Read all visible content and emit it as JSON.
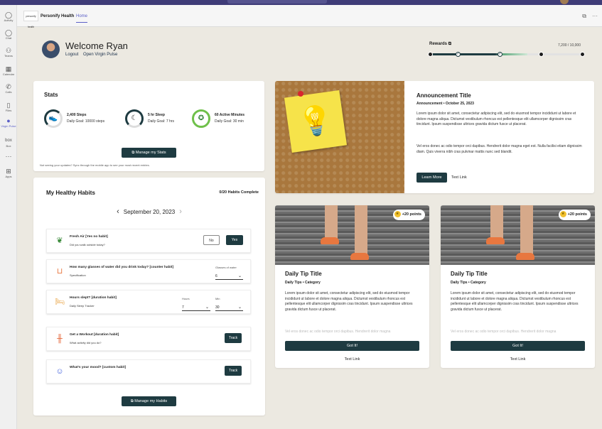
{
  "header": {
    "app_name": "Personify Health",
    "logo_text": "personify health",
    "tab": "Home"
  },
  "rail": [
    {
      "icon": "bell-icon",
      "glyph": "◯",
      "label": "Activity"
    },
    {
      "icon": "chat-icon",
      "glyph": "◯",
      "label": "Chat"
    },
    {
      "icon": "teams-icon",
      "glyph": "⚇",
      "label": "Teams"
    },
    {
      "icon": "calendar-icon",
      "glyph": "▦",
      "label": "Calendar"
    },
    {
      "icon": "calls-icon",
      "glyph": "✆",
      "label": "Calls"
    },
    {
      "icon": "files-icon",
      "glyph": "▯",
      "label": "Files"
    },
    {
      "icon": "virgin-pulse-icon",
      "glyph": "●",
      "label": "Virgin Pulse"
    },
    {
      "icon": "box-icon",
      "glyph": "box",
      "label": "Box"
    },
    {
      "icon": "more-icon",
      "glyph": "···",
      "label": ""
    },
    {
      "icon": "apps-icon",
      "glyph": "⊞",
      "label": "Apps"
    }
  ],
  "welcome": {
    "title": "Welcome Ryan",
    "logout": "Logout",
    "open": "Open Virgin Pulse"
  },
  "rewards": {
    "label": "Rewards",
    "value": "7,200 / 10,000",
    "progress": 0.72
  },
  "stats": {
    "title": "Stats",
    "items": [
      {
        "title": "2,400 Steps",
        "sub": "Daily Goal: 10000 steps",
        "icon": "shoe-icon",
        "glyph": "👟"
      },
      {
        "title": "5 hr Sleep",
        "sub": "Daily Goal: 7 hrs",
        "icon": "moon-icon",
        "glyph": "☾"
      },
      {
        "title": "60 Active Minutes",
        "sub": "Daily Goal: 30 min",
        "icon": "running-person-icon",
        "glyph": "✪"
      }
    ],
    "manage": "Manage my Stats",
    "sync_note": "Not seeing your updates? Sync through the mobile app to see your most recent entries."
  },
  "habits": {
    "title": "My Healthy Habits",
    "count": "0/20 Habits Complete",
    "date": "September 20, 2023",
    "items": [
      {
        "title": "Fresh Air [Yes no habit]",
        "sub": "Did you walk outside today?",
        "no": "No",
        "yes": "Yes"
      },
      {
        "title": "How many glasses of water did you drink today? [counter habit]",
        "sub": "Specification",
        "dd_label": "Glasses of water",
        "dd_value": "6"
      },
      {
        "title": "Hours slept? [duration habit]",
        "sub": "Daily Sleep Tracker",
        "h_label": "Hours",
        "h_value": "7",
        "m_label": "Min",
        "m_value": "30"
      },
      {
        "title": "Get a Workout [duration habit]",
        "sub": "What activity did you do?",
        "btn": "Track"
      },
      {
        "title": "What's your mood? [custom habit]",
        "sub": "",
        "btn": "Track"
      }
    ],
    "manage": "Manage my Habits"
  },
  "announcement": {
    "title": "Announcement Title",
    "meta": "Announcement  •  October 25, 2023",
    "p1": "Lorem ipsum dolor sit amet, consectetur adipiscing elit, sed do eiusmod tempor incididunt ut labore et dolore magna aliqua. Dictumst vestibulum rhoncus est pellentesque elit ullamcorper dignissim cras tincidunt. Ipsum suspendisse ultrices gravida dictum fusce ut placerat.",
    "p2": "Vel eros donec ac odio tempor orci dapibus. Hendrerit dolor magna eget est. Nulla facilisi etiam dignissim diam. Quis viverra nibh cras pulvinar mattis nunc sed blandit.",
    "learn": "Learn More",
    "link": "Text Link"
  },
  "tips": [
    {
      "points": "+20 points",
      "title": "Daily Tip Title",
      "meta": "Daily Tips  •  Category",
      "p1": "Lorem ipsum dolor sit amet, consectetur adipiscing elit, sed do eiusmod tempor incididunt ut labore et dolore magna aliqua. Dictumst vestibulum rhoncus est pellentesque elit ullamcorper dignissim cras tincidunt. Ipsum suspendisse ultrices gravida dictum fusce ut placerat.",
      "p2": "Vel eros donec ac odio tempor orci dapibus. Hendrerit dolor magna",
      "got": "Got It!",
      "link": "Text Link"
    },
    {
      "points": "+20 points",
      "title": "Daily Tip Title",
      "meta": "Daily Tips  •  Category",
      "p1": "Lorem ipsum dolor sit amet, consectetur adipiscing elit, sed do eiusmod tempor incididunt ut labore et dolore magna aliqua. Dictumst vestibulum rhoncus est pellentesque elit ullamcorper dignissim cras tincidunt. Ipsum suspendisse ultrices gravida dictum fusce ut placerat.",
      "p2": "Vel eros donec ac odio tempor orci dapibus. Hendrerit dolor magna",
      "got": "Got It!",
      "link": "Text Link"
    }
  ],
  "colors": {
    "primary": "#1e3b41",
    "accent": "#5b5fc7",
    "background": "#ece9e1"
  }
}
